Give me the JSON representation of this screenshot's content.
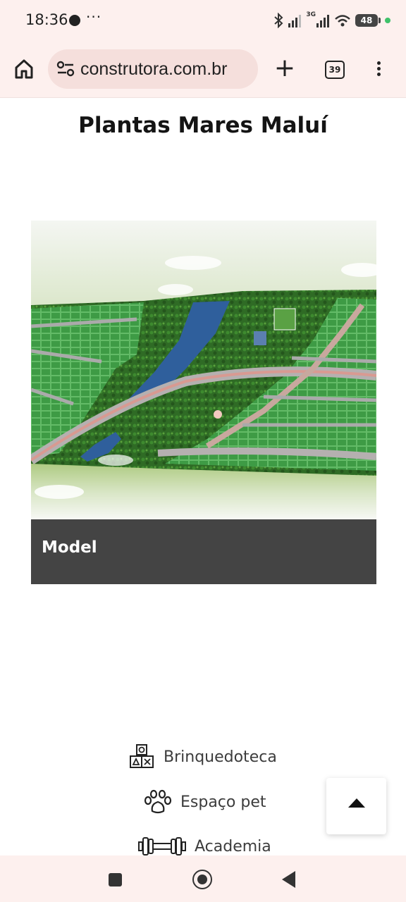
{
  "status_bar": {
    "time": "18:36",
    "more": "···",
    "network": "3G",
    "battery": "48"
  },
  "browser": {
    "url": "construtora.com.br",
    "tab_count": "39"
  },
  "page": {
    "title": "Plantas Mares Maluí",
    "image_caption": "Model",
    "amenities": [
      {
        "label": "Brinquedoteca",
        "icon": "toy-blocks-icon"
      },
      {
        "label": "Espaço pet",
        "icon": "paw-icon"
      },
      {
        "label": "Academia",
        "icon": "dumbbell-icon"
      }
    ]
  },
  "colors": {
    "system_bar_bg": "#fdf0ee",
    "url_pill_bg": "#f5dfdc",
    "caption_bg": "#444444",
    "green_dot": "#3fc16a"
  }
}
